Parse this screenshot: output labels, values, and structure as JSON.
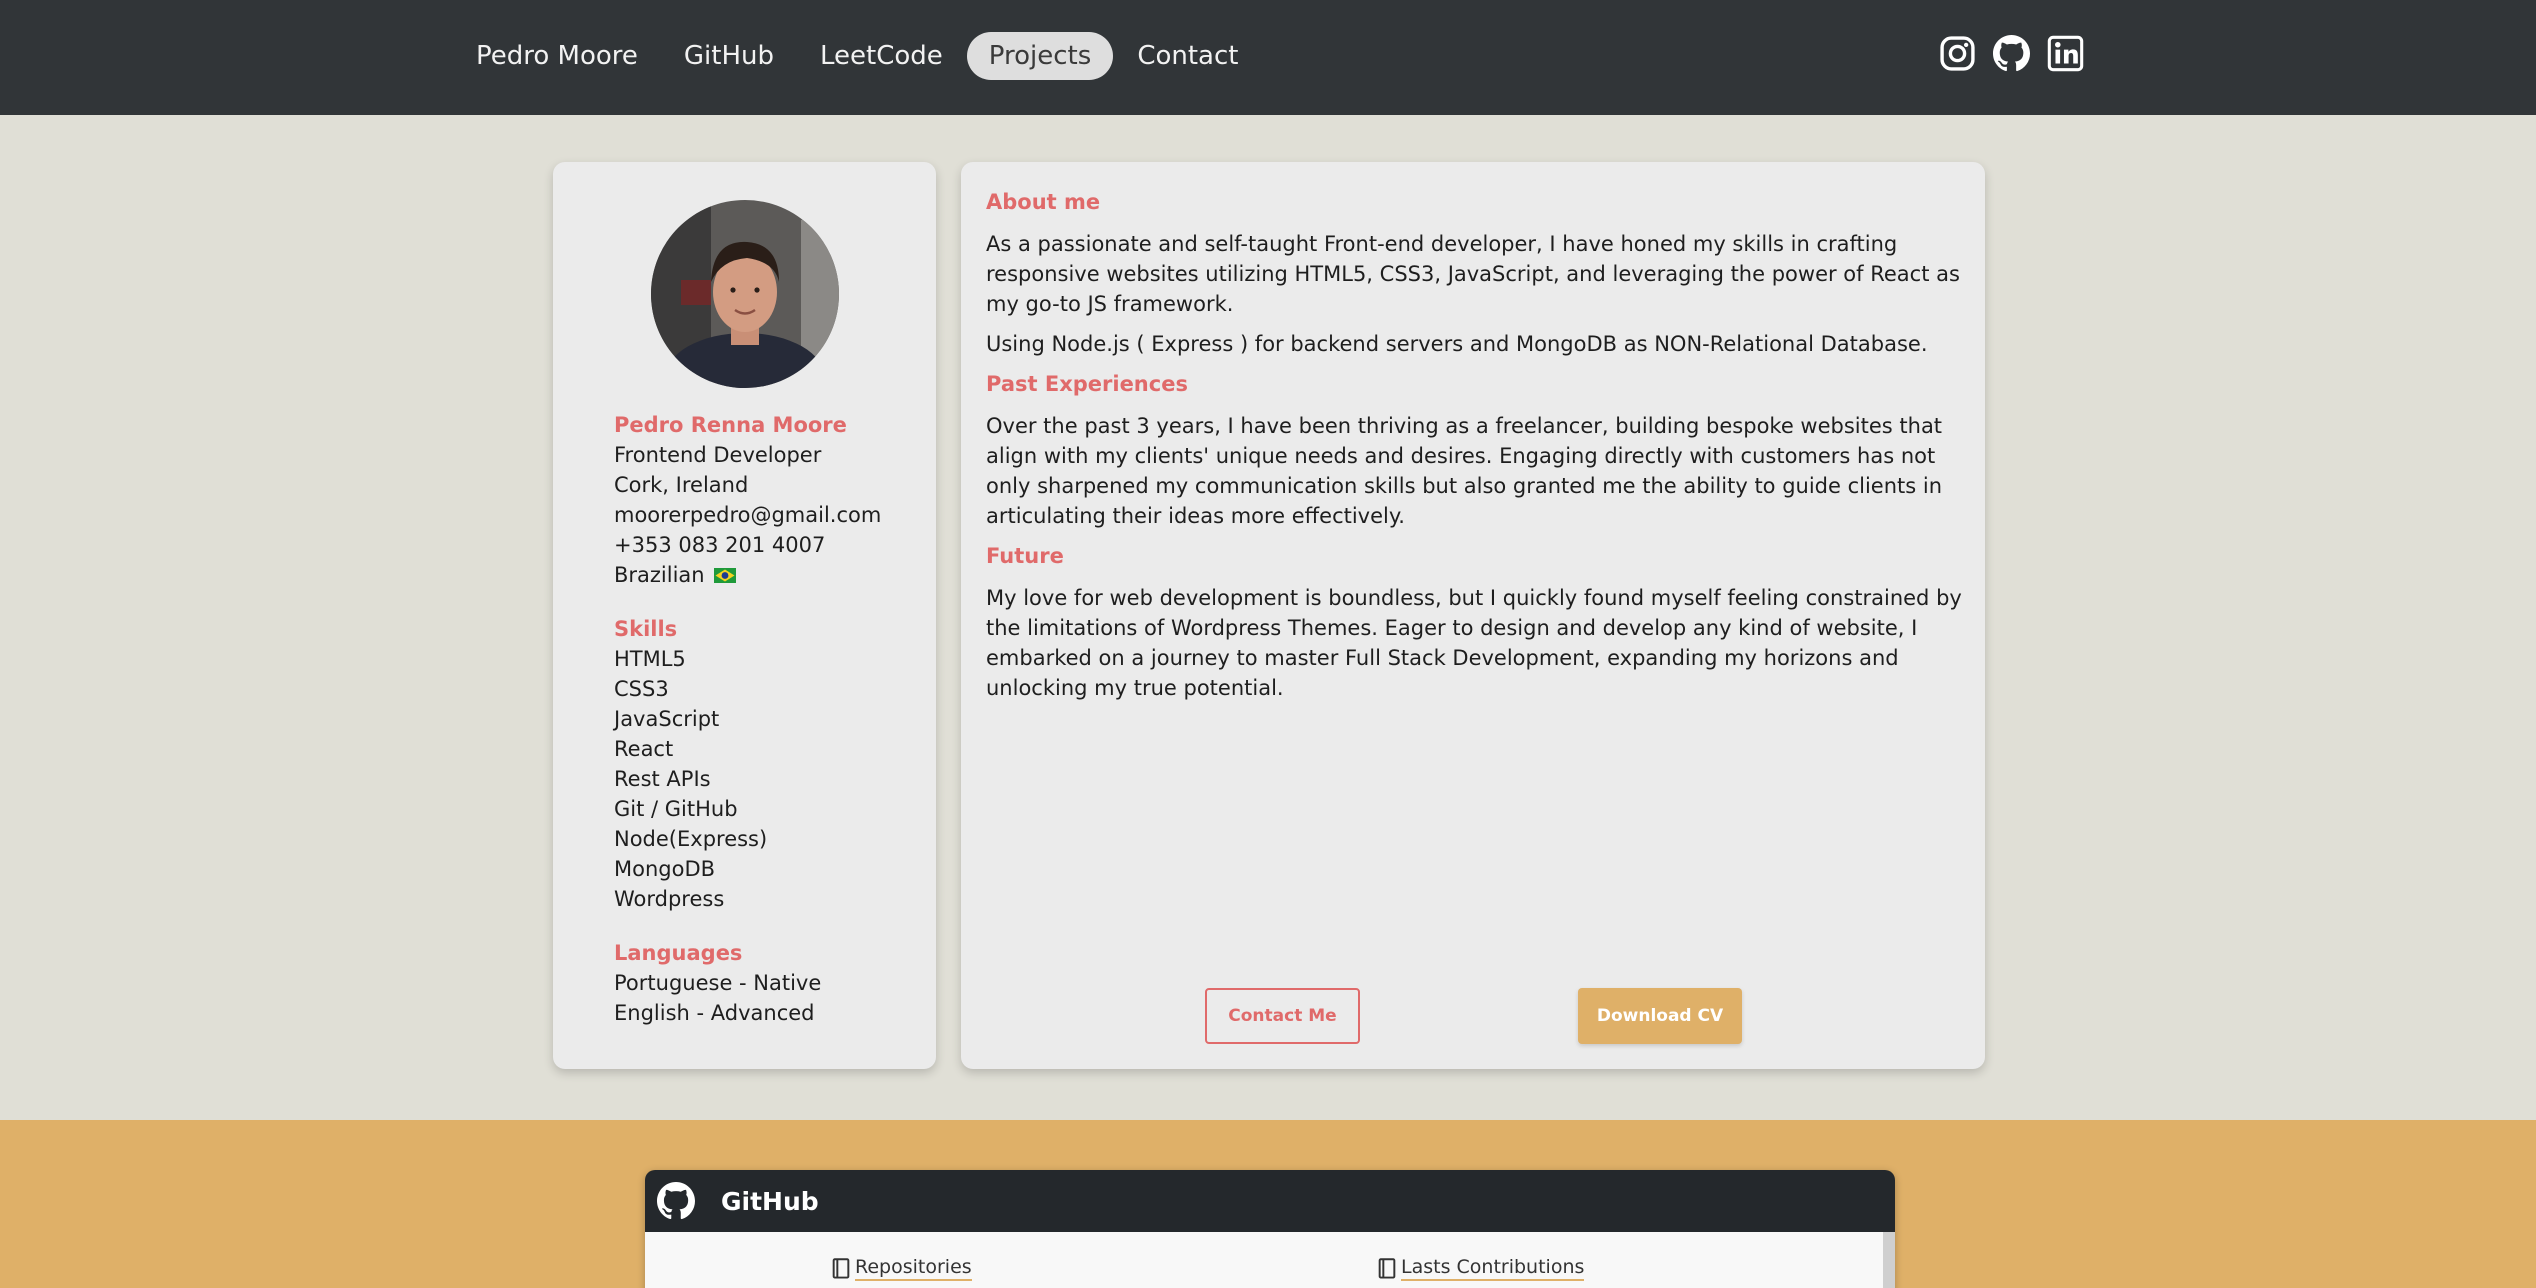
{
  "nav": {
    "items": [
      {
        "label": "Pedro Moore",
        "active": false
      },
      {
        "label": "GitHub",
        "active": false
      },
      {
        "label": "LeetCode",
        "active": false
      },
      {
        "label": "Projects",
        "active": true
      },
      {
        "label": "Contact",
        "active": false
      }
    ],
    "social_icons": [
      "instagram-icon",
      "github-icon",
      "linkedin-icon"
    ]
  },
  "profile": {
    "name": "Pedro Renna Moore",
    "role": "Frontend Developer",
    "location": "Cork, Ireland",
    "email": "moorerpedro@gmail.com",
    "phone": "+353 083 201 4007",
    "nationality": "Brazilian"
  },
  "skills": {
    "heading": "Skills",
    "items": [
      "HTML5",
      "CSS3",
      "JavaScript",
      "React",
      "Rest APIs",
      "Git / GitHub",
      "Node(Express)",
      "MongoDB",
      "Wordpress"
    ]
  },
  "languages": {
    "heading": "Languages",
    "items": [
      "Portuguese - Native",
      "English - Advanced"
    ]
  },
  "about": {
    "title": "About me",
    "p1": "As a passionate and self-taught Front-end developer, I have honed my skills in crafting responsive websites utilizing HTML5, CSS3, JavaScript, and leveraging the power of React as my go-to JS framework.",
    "p2": "Using Node.js ( Express ) for backend servers and MongoDB as NON-Relational Database."
  },
  "past": {
    "title": "Past Experiences",
    "p1": "Over the past 3 years, I have been thriving as a freelancer, building bespoke websites that align with my clients' unique needs and desires. Engaging directly with customers has not only sharpened my communication skills but also granted me the ability to guide clients in articulating their ideas more effectively."
  },
  "future": {
    "title": "Future",
    "p1": "My love for web development is boundless, but I quickly found myself feeling constrained by the limitations of Wordpress Themes. Eager to design and develop any kind of website, I embarked on a journey to master Full Stack Development, expanding my horizons and unlocking my true potential."
  },
  "buttons": {
    "contact": "Contact Me",
    "cv": "Download CV"
  },
  "github": {
    "title": "GitHub",
    "tab_repos": "Repositories",
    "tab_contrib": "Lasts Contributions"
  },
  "colors": {
    "accent": "#e06a6a",
    "gold": "#dfb068",
    "navbar": "#313538",
    "background": "#e0dfd6"
  }
}
